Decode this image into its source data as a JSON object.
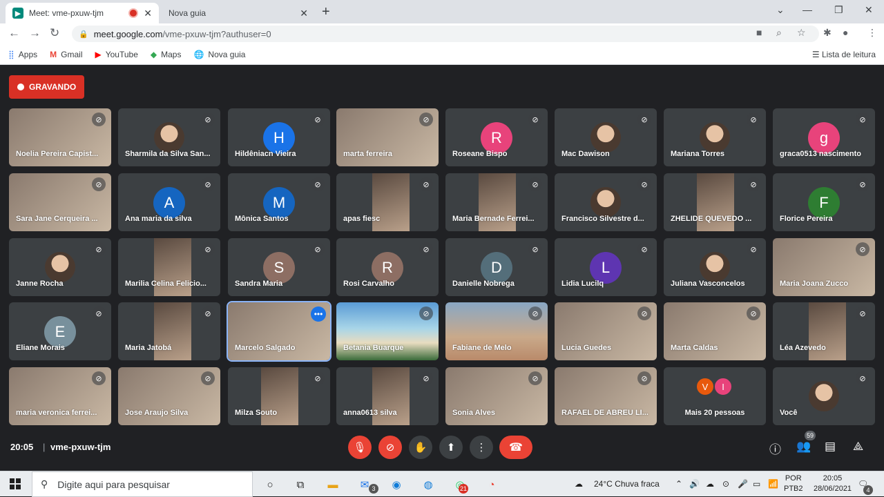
{
  "browser": {
    "tabs": [
      {
        "title": "Meet: vme-pxuw-tjm",
        "active": true
      },
      {
        "title": "Nova guia",
        "active": false
      }
    ],
    "new_tab": "+",
    "url_domain": "meet.google.com",
    "url_path": "/vme-pxuw-tjm?authuser=0",
    "bookmarks": [
      {
        "label": "Apps",
        "icon": "apps-grid-icon"
      },
      {
        "label": "Gmail",
        "icon": "gmail-icon"
      },
      {
        "label": "YouTube",
        "icon": "youtube-icon"
      },
      {
        "label": "Maps",
        "icon": "maps-icon"
      },
      {
        "label": "Nova guia",
        "icon": "globe-icon"
      }
    ],
    "reading_list": "Lista de leitura"
  },
  "meet": {
    "recording_label": "GRAVANDO",
    "participants": [
      {
        "name": "Noelia Pereira Capist...",
        "type": "video"
      },
      {
        "name": "Sharmila da Silva San...",
        "type": "photo"
      },
      {
        "name": "Hildêniacn Vieira",
        "type": "avatar",
        "initial": "H",
        "color": "#1a73e8"
      },
      {
        "name": "marta ferreira",
        "type": "video"
      },
      {
        "name": "Roseane Bispo",
        "type": "avatar",
        "initial": "R",
        "color": "#e8437b"
      },
      {
        "name": "Mac Dawison",
        "type": "photo"
      },
      {
        "name": "Mariana Torres",
        "type": "photo"
      },
      {
        "name": "graca0513 nascimento",
        "type": "avatar",
        "initial": "g",
        "color": "#e8437b"
      },
      {
        "name": "Sara Jane Cerqueira ...",
        "type": "video"
      },
      {
        "name": "Ana maria da silva",
        "type": "avatar",
        "initial": "A",
        "color": "#1565c0"
      },
      {
        "name": "Mônica Santos",
        "type": "avatar",
        "initial": "M",
        "color": "#1565c0"
      },
      {
        "name": "apas fiesc",
        "type": "vidblock"
      },
      {
        "name": "Maria Bernade Ferrei...",
        "type": "vidblock"
      },
      {
        "name": "Francisco Silvestre d...",
        "type": "photo"
      },
      {
        "name": "ZHELIDE QUEVEDO ...",
        "type": "vidblock"
      },
      {
        "name": "Florice Pereira",
        "type": "avatar",
        "initial": "F",
        "color": "#2e7d32"
      },
      {
        "name": "Janne Rocha",
        "type": "photo"
      },
      {
        "name": "Marilia Celina Felicio...",
        "type": "vidblock"
      },
      {
        "name": "Sandra Maria",
        "type": "avatar",
        "initial": "S",
        "color": "#8d6e63"
      },
      {
        "name": "Rosi Carvalho",
        "type": "avatar",
        "initial": "R",
        "color": "#8d6e63"
      },
      {
        "name": "Danielle Nobrega",
        "type": "avatar",
        "initial": "D",
        "color": "#546e7a"
      },
      {
        "name": "Lidia Lucilq",
        "type": "avatar",
        "initial": "L",
        "color": "#5e35b1"
      },
      {
        "name": "Juliana Vasconcelos",
        "type": "photo"
      },
      {
        "name": "Maria Joana Zucco",
        "type": "video"
      },
      {
        "name": "Eliane Morais",
        "type": "avatar",
        "initial": "E",
        "color": "#78909c"
      },
      {
        "name": "Maria Jatobá",
        "type": "vidblock"
      },
      {
        "name": "Marcelo Salgado",
        "type": "video",
        "active": true
      },
      {
        "name": "Betania Buarque",
        "type": "beach"
      },
      {
        "name": "Fabiane de Melo",
        "type": "sunset"
      },
      {
        "name": "Lucia Guedes",
        "type": "video"
      },
      {
        "name": "Marta Caldas",
        "type": "video"
      },
      {
        "name": "Léa Azevedo",
        "type": "vidblock"
      },
      {
        "name": "maria veronica ferrei...",
        "type": "video"
      },
      {
        "name": "Jose Araujo Silva",
        "type": "video"
      },
      {
        "name": "Milza Souto",
        "type": "vidblock"
      },
      {
        "name": "anna0613 silva",
        "type": "vidblock"
      },
      {
        "name": "Sonia Alves",
        "type": "video"
      },
      {
        "name": "RAFAEL DE ABREU LI...",
        "type": "video"
      },
      {
        "name": "Mais 20 pessoas",
        "type": "more",
        "minis": [
          {
            "initial": "V",
            "color": "#e8590c"
          },
          {
            "initial": "I",
            "color": "#e8437b"
          }
        ]
      },
      {
        "name": "Você",
        "type": "photo"
      }
    ],
    "time": "20:05",
    "separator": "|",
    "meeting_code": "vme-pxuw-tjm",
    "participant_count": "59"
  },
  "taskbar": {
    "search_placeholder": "Digite aqui para pesquisar",
    "mail_badge": "3",
    "whatsapp_badge": "21",
    "weather": "24°C  Chuva fraca",
    "lang_top": "POR",
    "lang_bottom": "PTB2",
    "clock_time": "20:05",
    "clock_date": "28/06/2021",
    "notif_count": "4"
  },
  "colors": {
    "meet_bg": "#202124",
    "tile_bg": "#3c4043",
    "record_red": "#d93025",
    "hangup_red": "#ea4335"
  }
}
